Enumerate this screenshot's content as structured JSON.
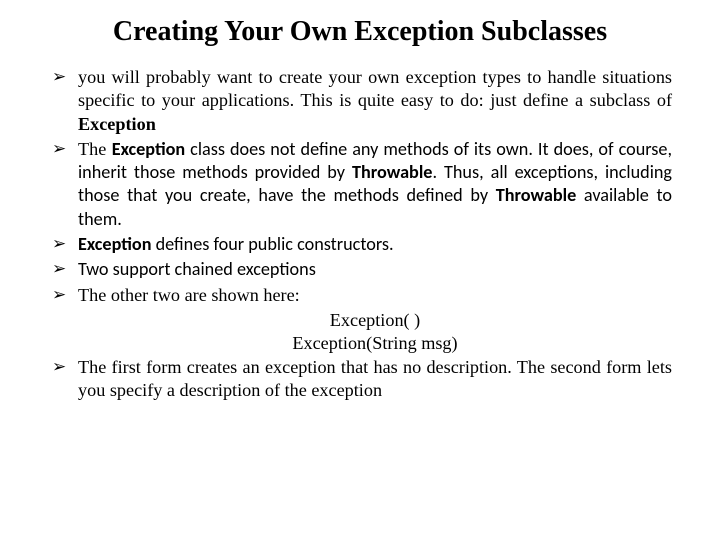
{
  "title": "Creating Your Own Exception Subclasses",
  "b1_p1": "you will probably want to create your own exception types to handle situations specific to your applications. This is quite easy to do: just define a subclass of ",
  "b1_p2": "Exception",
  "b2_p1": "The ",
  "b2_p2": "Exception ",
  "b2_p3": "class does not define any methods of its own. It does, of course, inherit those methods provided by ",
  "b2_p4": "Throwable",
  "b2_p5": ". Thus, all exceptions, including those that you create, have the methods defined by ",
  "b2_p6": "Throwable ",
  "b2_p7": "available to them.",
  "b3_p1": "Exception ",
  "b3_p2": "defines four public constructors.",
  "b4": "Two support chained exceptions",
  "b5": "The other two are shown here:",
  "sig1": "Exception( )",
  "sig2": "Exception(String msg)",
  "b6": "The first form creates an exception that has no description. The second form lets you specify a description of the exception"
}
